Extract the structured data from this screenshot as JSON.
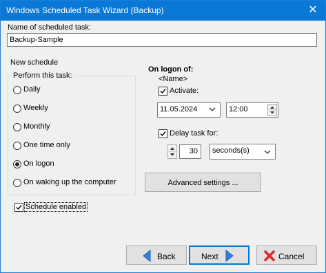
{
  "window": {
    "title": "Windows Scheduled Task Wizard (Backup)",
    "close_glyph": "✕"
  },
  "task_name": {
    "label": "Name of scheduled task:",
    "value": "Backup-Sample"
  },
  "new_schedule_label": "New schedule",
  "perform_group": {
    "title": "Perform this task:",
    "options": [
      {
        "label": "Daily",
        "selected": false
      },
      {
        "label": "Weekly",
        "selected": false
      },
      {
        "label": "Monthly",
        "selected": false
      },
      {
        "label": "One time only",
        "selected": false
      },
      {
        "label": "On logon",
        "selected": true
      },
      {
        "label": "On waking up the computer",
        "selected": false
      }
    ]
  },
  "schedule_enabled": {
    "label": "Schedule enabled",
    "checked": true
  },
  "logon": {
    "heading": "On logon of:",
    "user": "<Name>",
    "activate_label": "Activate:",
    "activate_checked": true,
    "date_value": "11.05.2024",
    "time_value": "12:00",
    "delay_label": "Delay task for:",
    "delay_checked": true,
    "delay_value": "30",
    "delay_unit": "seconds(s)",
    "advanced_label": "Advanced settings ..."
  },
  "buttons": {
    "back": "Back",
    "next": "Next",
    "cancel": "Cancel"
  },
  "icons": {
    "back": "arrow-left-icon",
    "next": "arrow-right-icon",
    "cancel": "red-x-icon"
  },
  "colors": {
    "titlebar": "#0a78d7",
    "arrow_blue": "#3c7fd8",
    "cancel_red": "#d92b2b",
    "default_border": "#0078d7"
  }
}
